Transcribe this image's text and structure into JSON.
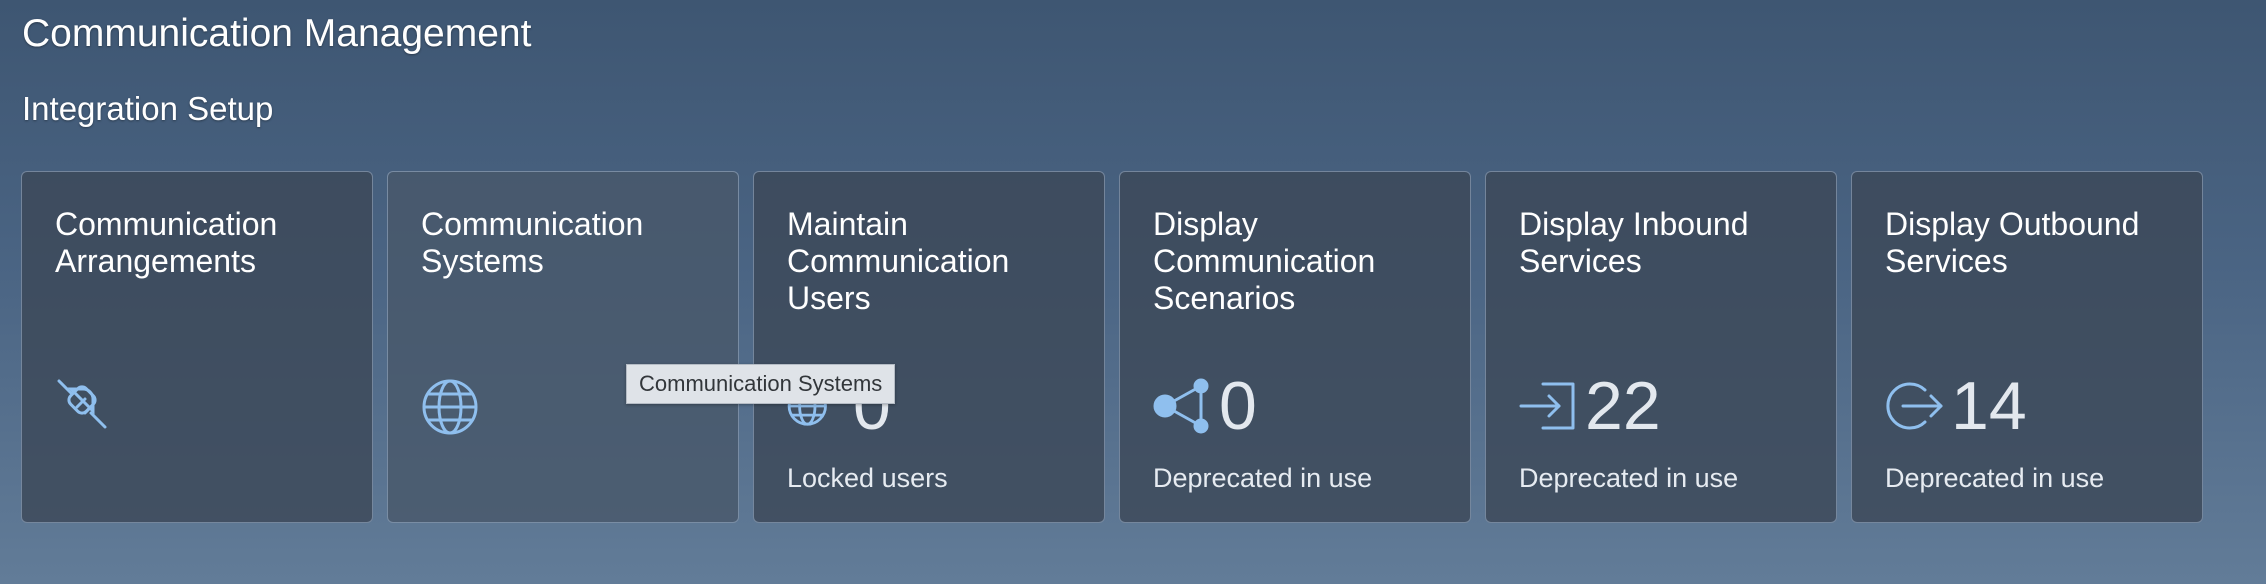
{
  "page": {
    "title": "Communication Management",
    "section_title": "Integration Setup"
  },
  "tiles": [
    {
      "title": "Communication Arrangements",
      "icon": "plug-disconnected-icon"
    },
    {
      "title": "Communication Systems",
      "icon": "globe-icon"
    },
    {
      "title": "Maintain Communication Users",
      "icon": "globe-icon",
      "value": "0",
      "footer": "Locked users"
    },
    {
      "title": "Display Communication Scenarios",
      "icon": "network-share-icon",
      "value": "0",
      "footer": "Deprecated in use"
    },
    {
      "title": "Display Inbound Services",
      "icon": "inbound-arrow-icon",
      "value": "22",
      "footer": "Deprecated in use"
    },
    {
      "title": "Display Outbound Services",
      "icon": "outbound-arrow-icon",
      "value": "14",
      "footer": "Deprecated in use"
    }
  ],
  "tooltip": {
    "text": "Communication Systems"
  },
  "colors": {
    "icon_accent": "#8fbfee",
    "tile_background": "#3c4858",
    "tooltip_background": "#dfe3e8"
  }
}
